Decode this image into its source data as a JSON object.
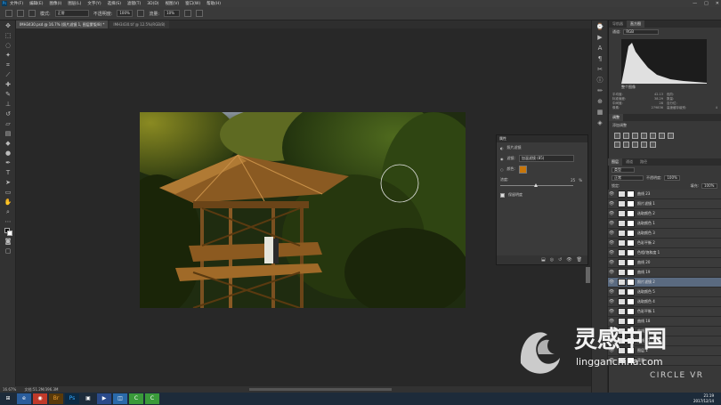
{
  "menubar": {
    "items": [
      "文件(F)",
      "编辑(E)",
      "图像(I)",
      "图层(L)",
      "文字(Y)",
      "选择(S)",
      "滤镜(T)",
      "3D(D)",
      "视图(V)",
      "窗口(W)",
      "帮助(H)"
    ],
    "window_controls": [
      "—",
      "□",
      "✕"
    ]
  },
  "options": {
    "mode_label": "模式:",
    "mode_value": "正常",
    "opacity_label": "不透明度:",
    "opacity_value": "100%",
    "flow_label": "流量:",
    "flow_value": "10%"
  },
  "tabs": [
    {
      "label": "IMH3430.psd @ 16.7% (照片滤镜 1, 图层蒙版/8) *",
      "active": true
    },
    {
      "label": "IMH3430.tif @ 12.5%(RGB/8)",
      "active": false
    }
  ],
  "status": {
    "zoom": "16.67%",
    "doc": "文档:51.2M/396.3M"
  },
  "properties": {
    "title": "属性",
    "subtitle": "照片滤镜",
    "filter_label": "滤镜:",
    "filter_value": "加温滤镜 (85)",
    "color_label": "颜色:",
    "density_label": "浓度:",
    "density_value": "25",
    "density_unit": "%",
    "preserve_label": "保留明度",
    "accent": "#c8760a"
  },
  "histogram": {
    "tabs": [
      "导航器",
      "直方图"
    ],
    "channel_label": "通道:",
    "channel_value": "RGB",
    "source_value": "整个图像",
    "stats_left": [
      [
        "平均值:",
        "42.13"
      ],
      [
        "标准偏差:",
        "38.29"
      ],
      [
        "中间值:",
        "28"
      ],
      [
        "像素:",
        "279836"
      ]
    ],
    "stats_right": [
      [
        "色阶:",
        ""
      ],
      [
        "数量:",
        ""
      ],
      [
        "百分位:",
        ""
      ],
      [
        "高速缓存级别:",
        "4"
      ]
    ]
  },
  "adjustments": {
    "tabs": [
      "调整"
    ],
    "add_label": "添加调整"
  },
  "layers": {
    "tabs": [
      "图层",
      "通道",
      "路径"
    ],
    "kind_label": "类型",
    "blend_value": "正常",
    "opacity_label": "不透明度:",
    "opacity_value": "100%",
    "lock_label": "锁定:",
    "fill_label": "填充:",
    "fill_value": "100%",
    "rows": [
      {
        "name": "曲线 23",
        "sel": false
      },
      {
        "name": "照片滤镜 1",
        "sel": false
      },
      {
        "name": "选取颜色 2",
        "sel": false
      },
      {
        "name": "选取颜色 1",
        "sel": false
      },
      {
        "name": "选取颜色 3",
        "sel": false
      },
      {
        "name": "色彩平衡 2",
        "sel": false
      },
      {
        "name": "色相/饱和度 1",
        "sel": false
      },
      {
        "name": "曲线 20",
        "sel": false
      },
      {
        "name": "曲线 19",
        "sel": false
      },
      {
        "name": "照片滤镜 2",
        "sel": true
      },
      {
        "name": "选取颜色 5",
        "sel": false
      },
      {
        "name": "选取颜色 4",
        "sel": false
      },
      {
        "name": "色彩平衡 1",
        "sel": false
      },
      {
        "name": "曲线 18",
        "sel": false
      },
      {
        "name": "曲线 16",
        "sel": false
      },
      {
        "name": "曲线 17",
        "sel": false
      },
      {
        "name": "图层 1",
        "sel": false
      },
      {
        "name": "背景",
        "sel": false
      }
    ]
  },
  "taskbar": {
    "apps": [
      "⊞",
      "e",
      "◉",
      "Br",
      "Ps",
      "▣",
      "▶",
      "◫",
      "C",
      "C"
    ]
  },
  "clock": {
    "time": "21:19",
    "date": "2017/12/14"
  },
  "watermark": {
    "brand": "灵感中国",
    "url": "lingganchina.com",
    "extra": "CIRCLE VR"
  }
}
